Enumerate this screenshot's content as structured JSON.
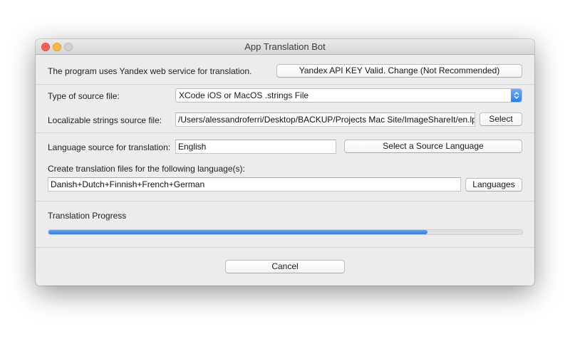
{
  "window": {
    "title": "App Translation Bot"
  },
  "api": {
    "info_label": "The program uses Yandex web service for translation.",
    "key_button_label": "Yandex API KEY Valid. Change (Not Recommended)"
  },
  "source": {
    "type_label": "Type of source file:",
    "type_selected": "XCode iOS or MacOS .strings File",
    "file_label": "Localizable strings source file:",
    "file_path": "/Users/alessandroferri/Desktop/BACKUP/Projects Mac Site/ImageShareIt/en.lp",
    "select_button_label": "Select"
  },
  "language": {
    "source_label": "Language source for translation:",
    "source_value": "English",
    "select_source_button_label": "Select a Source Language",
    "targets_label": "Create translation files for the following language(s):",
    "targets_value": "Danish+Dutch+Finnish+French+German",
    "languages_button_label": "Languages"
  },
  "progress": {
    "label": "Translation Progress",
    "fraction": 0.8
  },
  "footer": {
    "cancel_button_label": "Cancel"
  },
  "colors": {
    "accent": "#2f7cea",
    "close": "#fc605c",
    "minimize": "#fdbc40",
    "maximize_disabled": "#d0d0d0"
  },
  "icons": {
    "popup_arrow": "chevron-up-down-icon"
  }
}
